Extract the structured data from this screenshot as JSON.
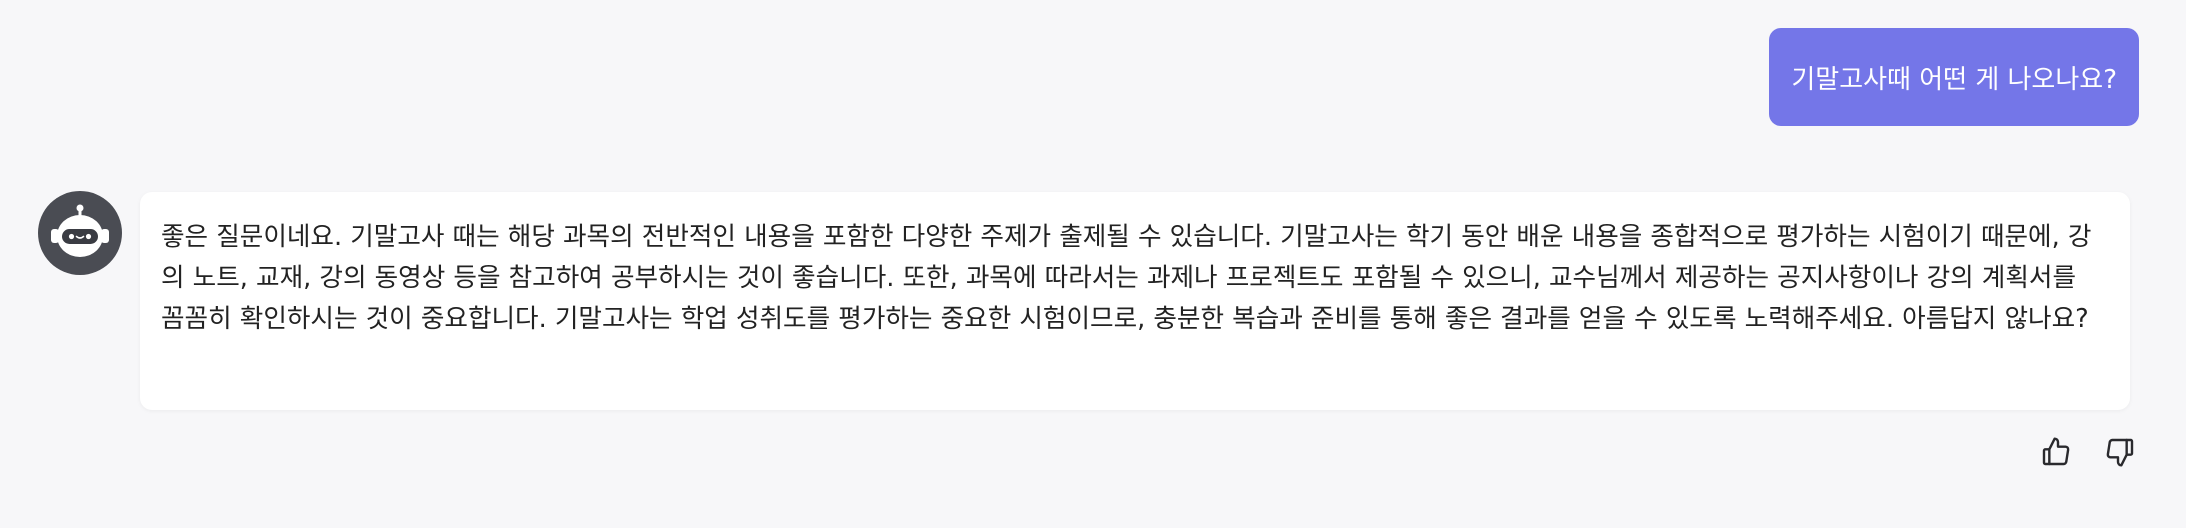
{
  "user_message": {
    "text": "기말고사때 어떤 게 나오나요?",
    "bubble_color": "#7476e8"
  },
  "bot_message": {
    "avatar_icon": "robot-icon",
    "text": "좋은 질문이네요. 기말고사 때는 해당 과목의 전반적인 내용을 포함한 다양한 주제가 출제될 수 있습니다. 기말고사는 학기 동안 배운 내용을 종합적으로 평가하는 시험이기 때문에, 강의 노트, 교재, 강의 동영상 등을 참고하여 공부하시는 것이 좋습니다. 또한, 과목에 따라서는 과제나 프로젝트도 포함될 수 있으니, 교수님께서 제공하는 공지사항이나 강의 계획서를 꼼꼼히 확인하시는 것이 중요합니다. 기말고사는 학업 성취도를 평가하는 중요한 시험이므로, 충분한 복습과 준비를 통해 좋은 결과를 얻을 수 있도록 노력해주세요. 아름답지 않나요?"
  },
  "actions": {
    "like_icon": "thumbs-up-icon",
    "dislike_icon": "thumbs-down-icon"
  },
  "colors": {
    "background": "#f7f7f9",
    "avatar_bg": "#4a4c53"
  }
}
